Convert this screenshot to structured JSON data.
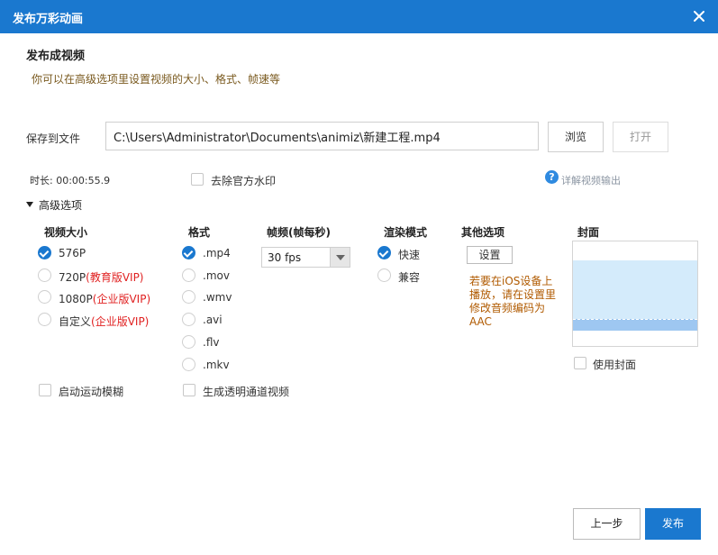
{
  "window": {
    "title": "发布万彩动画"
  },
  "header": {
    "heading": "发布成视频",
    "subheading": "你可以在高级选项里设置视频的大小、格式、帧速等"
  },
  "save": {
    "label": "保存到文件",
    "path": "C:\\Users\\Administrator\\Documents\\animiz\\新建工程.mp4",
    "browse_label": "浏览",
    "open_label": "打开"
  },
  "info": {
    "duration": "时长: 00:00:55.9",
    "remove_watermark_label": "去除官方水印",
    "help_link": "详解视频输出"
  },
  "advanced": {
    "toggle_label": "高级选项",
    "size": {
      "title": "视频大小",
      "options": [
        {
          "name": "576P",
          "vip": "",
          "selected": true
        },
        {
          "name": "720P",
          "vip": "(教育版VIP)",
          "selected": false
        },
        {
          "name": "1080P",
          "vip": "(企业版VIP)",
          "selected": false
        },
        {
          "name": "自定义",
          "vip": "(企业版VIP)",
          "selected": false
        }
      ]
    },
    "format": {
      "title": "格式",
      "options": [
        {
          "name": ".mp4",
          "selected": true
        },
        {
          "name": ".mov",
          "selected": false
        },
        {
          "name": ".wmv",
          "selected": false
        },
        {
          "name": ".avi",
          "selected": false
        },
        {
          "name": ".flv",
          "selected": false
        },
        {
          "name": ".mkv",
          "selected": false
        }
      ]
    },
    "fps": {
      "title": "帧频(帧每秒)",
      "value": "30 fps"
    },
    "render": {
      "title": "渲染模式",
      "options": [
        {
          "name": "快速",
          "selected": true
        },
        {
          "name": "兼容",
          "selected": false
        }
      ]
    },
    "other": {
      "title": "其他选项",
      "settings_label": "设置",
      "note": "若要在iOS设备上播放，请在设置里修改音频编码为AAC"
    },
    "cover": {
      "title": "封面",
      "use_cover_label": "使用封面"
    },
    "motion_blur_label": "启动运动模糊",
    "alpha_video_label": "生成透明通道视频"
  },
  "footer": {
    "prev_label": "上一步",
    "publish_label": "发布"
  },
  "colors": {
    "accent": "#1a78cf",
    "vip": "#e02020",
    "note": "#b05a00",
    "cover_fill": "#d4ebfb"
  }
}
